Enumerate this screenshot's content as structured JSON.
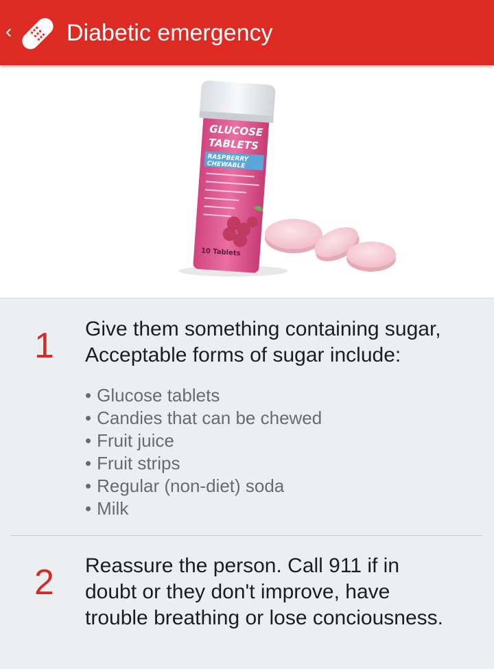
{
  "header": {
    "title": "Diabetic emergency",
    "back_icon": "back-chevron-icon",
    "app_icon": "bandage-icon",
    "color": "#dd2a22"
  },
  "hero_image": {
    "bottle_label_lines": [
      "GLUCOSE",
      "TABLETS",
      "RASPBERRY",
      "CHEWABLE"
    ],
    "bottle_count": "10 Tablets"
  },
  "steps": [
    {
      "number": "1",
      "text": "Give them something containing sugar, Acceptable forms of sugar include:",
      "bullets": [
        "Glucose tablets",
        "Candies that can be chewed",
        "Fruit juice",
        "Fruit strips",
        "Regular (non-diet) soda",
        "Milk"
      ]
    },
    {
      "number": "2",
      "text": "Reassure the person. Call 911 if in doubt or they don't improve, have trouble breathing or lose conciousness."
    }
  ],
  "colors": {
    "accent_red": "#d52b24",
    "background": "#eceff1"
  }
}
